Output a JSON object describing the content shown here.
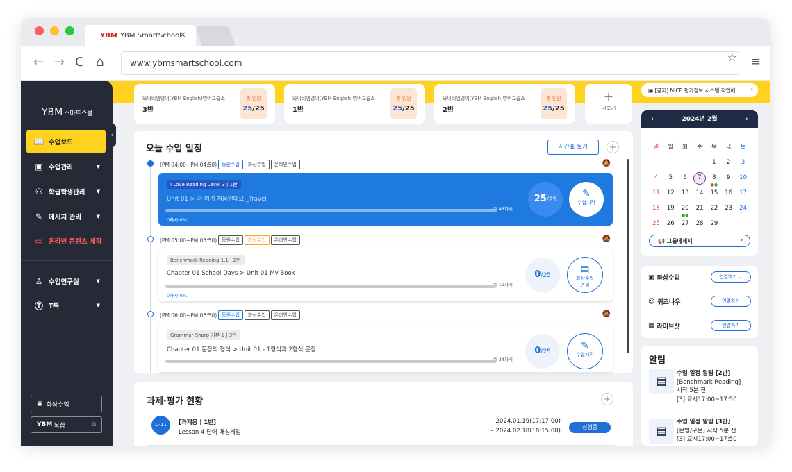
{
  "browser": {
    "tab_title": "YBM SmartSchool",
    "url": "www.ybmsmartschool.com"
  },
  "sidebar": {
    "logo": "YBM",
    "logo_sub": "스마트스쿨",
    "items": [
      {
        "label": "수업보드"
      },
      {
        "label": "수업관리"
      },
      {
        "label": "학급학생관리"
      },
      {
        "label": "메시지 관리"
      },
      {
        "label": "온라인 콘텐츠 제작"
      },
      {
        "label": "수업연구실"
      },
      {
        "label": "T톡"
      }
    ],
    "video_btn": "화상수업",
    "books_btn": "북샵",
    "books_logo": "YBM"
  },
  "classes": [
    {
      "name": "와이비엠영어(YBM English)영어교습소",
      "room": "3반",
      "count_label": "총 인원",
      "count": "25",
      "total": "/25"
    },
    {
      "name": "와이비엠영어(YBM English)영어교습소",
      "room": "1반",
      "count_label": "총 인원",
      "count": "25",
      "total": "/25"
    },
    {
      "name": "와이비엠영어(YBM English)영어교습소",
      "room": "2반",
      "count_label": "총 인원",
      "count": "25",
      "total": "/25"
    }
  ],
  "more_label": "더보기",
  "notice": "[공지] NICE 평가정보 시스템 작업에...",
  "schedule": {
    "title": "오늘 수업 일정",
    "timetable_btn": "시간표 보기",
    "lessons": [
      {
        "time": "(PM 04:00~PM 04:50)",
        "badges": [
          "등원수업",
          "화상수업",
          "온라인수업"
        ],
        "tag": "I Love Reading Level 3 | 1반",
        "title": "Unit 01 > 저 여기 처음인데요 _Travel",
        "sessions": "총 48차시",
        "progress": "0차시(0%)",
        "attend": "25",
        "attend_total": "/25",
        "action": "수업시작"
      },
      {
        "time": "(PM 05:00~PM 05:50)",
        "badges": [
          "등원수업",
          "화상수업",
          "온라인수업"
        ],
        "tag": "Benchmark Reading 1.1 | 2반",
        "title": "Chapter 01 School Days > Unit 01 My Book",
        "sessions": "총 12차시",
        "progress": "0차시(0%)",
        "attend": "0",
        "attend_total": "/25",
        "action": "화상수업\n연결"
      },
      {
        "time": "(PM 06:00~PM 06:50)",
        "badges": [
          "등원수업",
          "화상수업",
          "온라인수업"
        ],
        "tag": "Grammar Sharp 기본 1 | 3반",
        "title": "Chapter 01 문장의 형식 > Unit 01 - 1형식과 2형식 문장",
        "sessions": "총 34차시",
        "progress": "0차시(0%)",
        "attend": "0",
        "attend_total": "/25",
        "action": "수업시작"
      }
    ]
  },
  "tasks": {
    "title": "과제·평가 현황",
    "item": {
      "dday": "D-11",
      "title": "[과제용 | 1반]",
      "sub": "Lesson 4 단어 매칭게임",
      "date1": "2024.01.19(17:17:00)",
      "date2": "~ 2024.02.18(18:15:00)",
      "status": "진행중"
    }
  },
  "calendar": {
    "month": "2024년 2월",
    "weekdays": [
      "일",
      "월",
      "화",
      "수",
      "목",
      "금",
      "토"
    ],
    "weeks": [
      [
        "",
        "",
        "",
        "",
        "1",
        "2",
        "3"
      ],
      [
        "4",
        "5",
        "6",
        "7",
        "8",
        "9",
        "10"
      ],
      [
        "11",
        "12",
        "13",
        "14",
        "15",
        "16",
        "17"
      ],
      [
        "18",
        "19",
        "20",
        "21",
        "22",
        "23",
        "24"
      ],
      [
        "25",
        "26",
        "27",
        "28",
        "29",
        "",
        ""
      ]
    ],
    "group_msg": "그룹메세지"
  },
  "apps": [
    {
      "name": "화상수업",
      "btn": "연결하기"
    },
    {
      "name": "퀴즈나우",
      "btn": "연결하기"
    },
    {
      "name": "라이브샷",
      "btn": "연결하기"
    }
  ],
  "alerts": {
    "title": "알림",
    "items": [
      {
        "l1": "수업 일정 알림 [2반]",
        "l2": "[Benchmark Reading]",
        "l3": "시작 5분 전",
        "l4": "[3] 교시17:00~17:50"
      },
      {
        "l1": "수업 일정 알림 [3반]",
        "l2": "[문법/구문] 시작 5분 전",
        "l3": "[3] 교시17:00~17:50",
        "l4": ""
      }
    ]
  },
  "colors": {
    "accent": "#1f6fd6",
    "yellow": "#ffd21f",
    "sidebar": "#262a36"
  }
}
